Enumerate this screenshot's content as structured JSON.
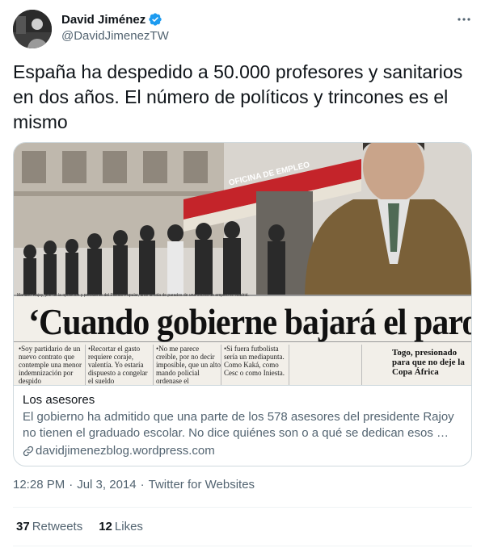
{
  "author": {
    "name": "David Jiménez",
    "handle": "@DavidJimenezTW",
    "verified": true
  },
  "tweet": {
    "text": "España ha despedido a 50.000 profesores y sanitarios en dos años. El número de políticos y trincones es el mismo"
  },
  "card": {
    "image": {
      "headline": "‘Cuando gobierne bajará el paro’",
      "sign": "OFICINA DE EMPLEO",
      "side_text": "Togo, presionado para que no deje la Copa África",
      "columns": [
        "•Soy partidario de un nuevo contrato que contemple una menor indemnización por despido",
        "•Recortar el gasto requiere coraje, valentía. Yo estaría dispuesto a congelar el sueldo",
        "•No me parece creíble, por no decir imposible, que un alto mando policial ordenase el",
        "•Si fuera futbolista sería un mediapunta. Como Kaká, como Cesc o como Iniesta."
      ],
      "caption": "Mariano Rajoy, jefe de la oposición y presidente del Partido Popular, ante la cola de parados de una oficina de empleo en Madrid."
    },
    "title": "Los asesores",
    "description": "El gobierno ha admitido que una parte de los 578 asesores del presidente Rajoy no tienen el graduado escolar. No dice quiénes son o a qué se dedican esos …",
    "domain": "davidjimenezblog.wordpress.com"
  },
  "meta": {
    "time": "12:28 PM",
    "date": "Jul 3, 2014",
    "separator": "·",
    "source": "Twitter for Websites"
  },
  "stats": {
    "retweets_count": "37",
    "retweets_label": "Retweets",
    "likes_count": "12",
    "likes_label": "Likes"
  },
  "icons": {
    "verified": "verified-badge-icon",
    "more": "more-options-icon",
    "link": "link-icon"
  },
  "colors": {
    "text_primary": "#0f1419",
    "text_secondary": "#536471",
    "verified_blue": "#1d9bf0",
    "border": "#cfd9de"
  }
}
